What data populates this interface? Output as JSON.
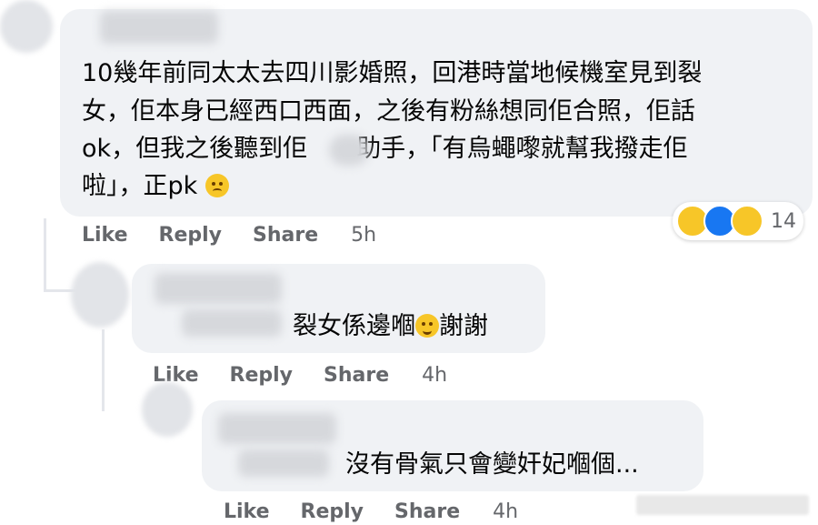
{
  "comments": [
    {
      "lines": [
        "10幾年前同太太去四川影婚照，回港時當地候機室見到裂",
        "女，佢本身已經西口西面，之後有粉絲想同佢合照，佢話",
        "ok，但我之後聽到佢　　助手，「有烏蠅嚟就幫我撥走佢",
        "啦」，正pk"
      ],
      "end_emoji": "weary-face-emoji",
      "actions": {
        "like": "Like",
        "reply": "Reply",
        "share": "Share",
        "time": "5h"
      },
      "reactions": {
        "icons": [
          "haha-reaction-icon",
          "like-reaction-icon",
          "wow-reaction-icon"
        ],
        "count": "14"
      }
    },
    {
      "text": "裂女係邊嗰",
      "text_after": "謝謝",
      "mid_emoji": "grinning-sweat-emoji",
      "actions": {
        "like": "Like",
        "reply": "Reply",
        "share": "Share",
        "time": "4h"
      }
    },
    {
      "text": "沒有骨氣只會變奸妃嗰個...",
      "actions": {
        "like": "Like",
        "reply": "Reply",
        "share": "Share",
        "time": "4h"
      }
    }
  ],
  "colors": {
    "bubble": "#f0f2f5",
    "meta": "#65676b",
    "text": "#050505",
    "like_blue": "#1877f2",
    "emoji_yellow": "#f7c628"
  }
}
